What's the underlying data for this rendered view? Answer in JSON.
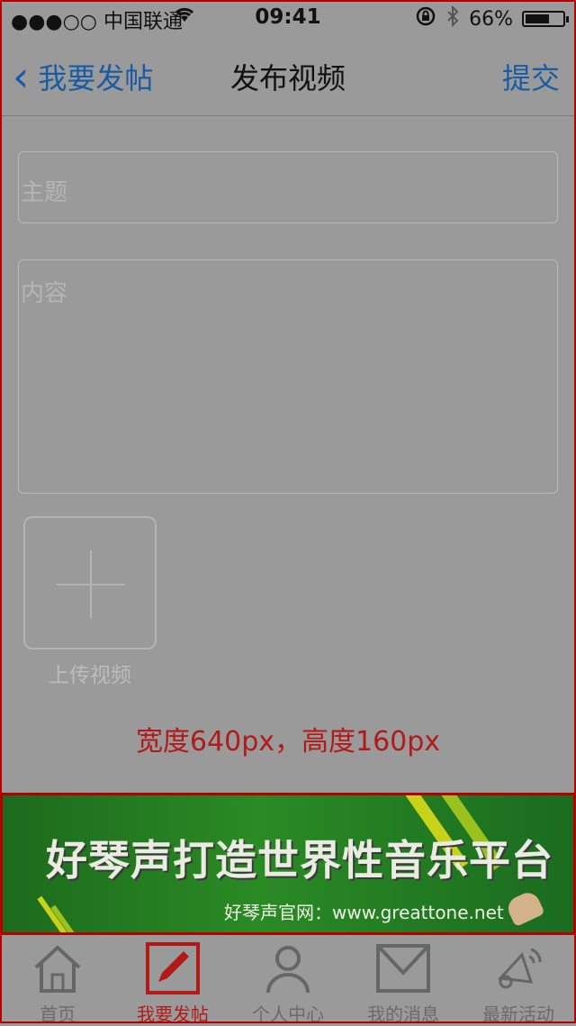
{
  "status_bar": {
    "carrier": "●●●○○ 中国联通",
    "time": "09:41",
    "battery": "66%",
    "battery_level": 0.66
  },
  "nav": {
    "back_label": "我要发帖",
    "title": "发布视频",
    "submit_label": "提交"
  },
  "form": {
    "subject_placeholder": "主题",
    "content_placeholder": "内容",
    "upload_label": "上传视频"
  },
  "note": "宽度640px，高度160px",
  "banner": {
    "headline": "好琴声打造世界性音乐平台",
    "site": "好琴声官网：www.greattone.net"
  },
  "tabbar": {
    "items": [
      {
        "label": "首页",
        "icon": "home-icon"
      },
      {
        "label": "我要发帖",
        "icon": "edit-icon",
        "active": true
      },
      {
        "label": "个人中心",
        "icon": "user-icon"
      },
      {
        "label": "我的消息",
        "icon": "mail-icon"
      },
      {
        "label": "最新活动",
        "icon": "megaphone-icon"
      }
    ]
  },
  "colors": {
    "accent_blue": "#1a5ca3",
    "active_red": "#b21a1a",
    "banner_green": "#2a8a24"
  }
}
